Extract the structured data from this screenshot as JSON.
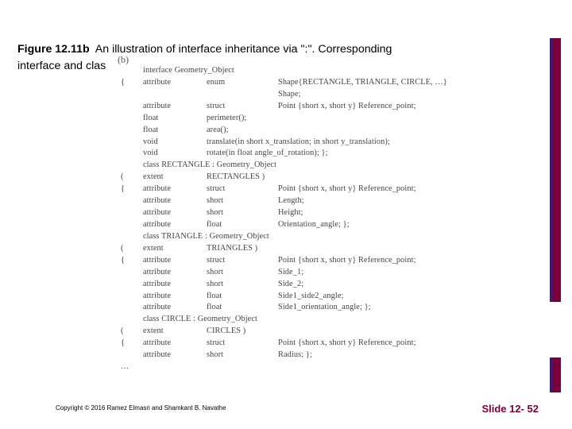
{
  "caption": {
    "figure_label": "Figure 12.11b",
    "text_line1": "An illustration of interface inheritance via \":\". Corresponding",
    "text_line2": "interface and clas"
  },
  "tab_label": "(b)",
  "code": {
    "rows": [
      {
        "c0": "",
        "c1": "interface Geometry_Object",
        "span": true
      },
      {
        "c0": "{",
        "c1": "attribute",
        "c2": "enum",
        "c3": "Shape{RECTANGLE, TRIANGLE, CIRCLE, …}"
      },
      {
        "c0": "",
        "c1": "",
        "c2": "",
        "c3": "Shape;"
      },
      {
        "c0": "",
        "c1": "attribute",
        "c2": "struct",
        "c3": "Point {short x, short y} Reference_point;"
      },
      {
        "c0": "",
        "c1": "float",
        "c2": "perimeter();",
        "c3": ""
      },
      {
        "c0": "",
        "c1": "float",
        "c2": "area();",
        "c3": ""
      },
      {
        "c0": "",
        "c1": "void",
        "c2": "translate(in short x_translation; in short y_translation);",
        "wide": true
      },
      {
        "c0": "",
        "c1": "void",
        "c2": "rotate(in float angle_of_rotation); };",
        "wide": true
      },
      {
        "c0": "",
        "c1": "class RECTANGLE : Geometry_Object",
        "span": true
      },
      {
        "c0": "(",
        "c1": "extent",
        "c2": "RECTANGLES )",
        "c3": ""
      },
      {
        "c0": "{",
        "c1": "attribute",
        "c2": "struct",
        "c3": "Point {short x, short y} Reference_point;"
      },
      {
        "c0": "",
        "c1": "attribute",
        "c2": "short",
        "c3": "Length;"
      },
      {
        "c0": "",
        "c1": "attribute",
        "c2": "short",
        "c3": "Height;"
      },
      {
        "c0": "",
        "c1": "attribute",
        "c2": "float",
        "c3": "Orientation_angle; };"
      },
      {
        "c0": "",
        "c1": "class TRIANGLE : Geometry_Object",
        "span": true
      },
      {
        "c0": "(",
        "c1": "extent",
        "c2": "TRIANGLES )",
        "c3": ""
      },
      {
        "c0": "{",
        "c1": "attribute",
        "c2": "struct",
        "c3": "Point {short x, short y} Reference_point;"
      },
      {
        "c0": "",
        "c1": "attribute",
        "c2": "short",
        "c3": "Side_1;"
      },
      {
        "c0": "",
        "c1": "attribute",
        "c2": "short",
        "c3": "Side_2;"
      },
      {
        "c0": "",
        "c1": "attribute",
        "c2": "float",
        "c3": "Side1_side2_angle;"
      },
      {
        "c0": "",
        "c1": "attribute",
        "c2": "float",
        "c3": "Side1_orientation_angle; };"
      },
      {
        "c0": "",
        "c1": "class CIRCLE : Geometry_Object",
        "span": true
      },
      {
        "c0": "(",
        "c1": "extent",
        "c2": "CIRCLES )",
        "c3": ""
      },
      {
        "c0": "{",
        "c1": "attribute",
        "c2": "struct",
        "c3": "Point {short x, short y} Reference_point;"
      },
      {
        "c0": "",
        "c1": "attribute",
        "c2": "short",
        "c3": "Radius; };"
      },
      {
        "c0": "…",
        "c1": "",
        "c2": "",
        "c3": ""
      }
    ]
  },
  "footer": {
    "copyright": "Copyright © 2016 Ramez Elmasri and Shamkant B. Navathe",
    "slide_number": "Slide 12- 52"
  }
}
